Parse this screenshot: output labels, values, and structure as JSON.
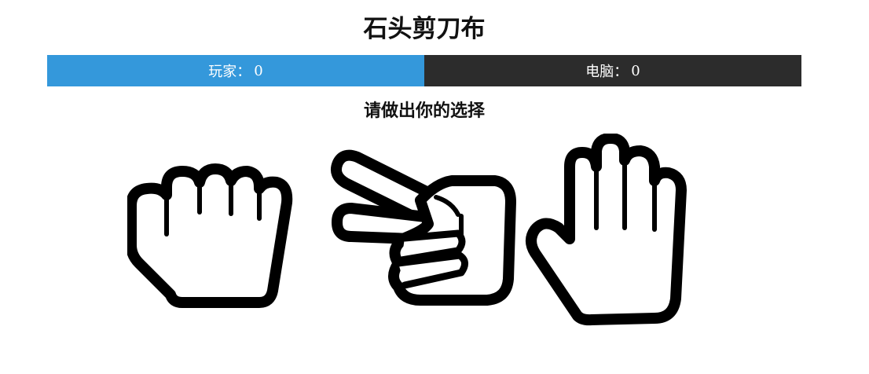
{
  "game": {
    "title": "石头剪刀布",
    "prompt": "请做出你的选择"
  },
  "scoreboard": {
    "player_label": "玩家",
    "player_score": "0",
    "computer_label": "电脑",
    "computer_score": "0",
    "separator": "："
  },
  "choices": [
    {
      "name": "rock",
      "icon": "fist-hand-icon"
    },
    {
      "name": "scissors",
      "icon": "peace-sign-hand-icon"
    },
    {
      "name": "paper",
      "icon": "open-palm-hand-icon"
    }
  ],
  "colors": {
    "player": "#3498db",
    "computer": "#2c2c2c"
  }
}
